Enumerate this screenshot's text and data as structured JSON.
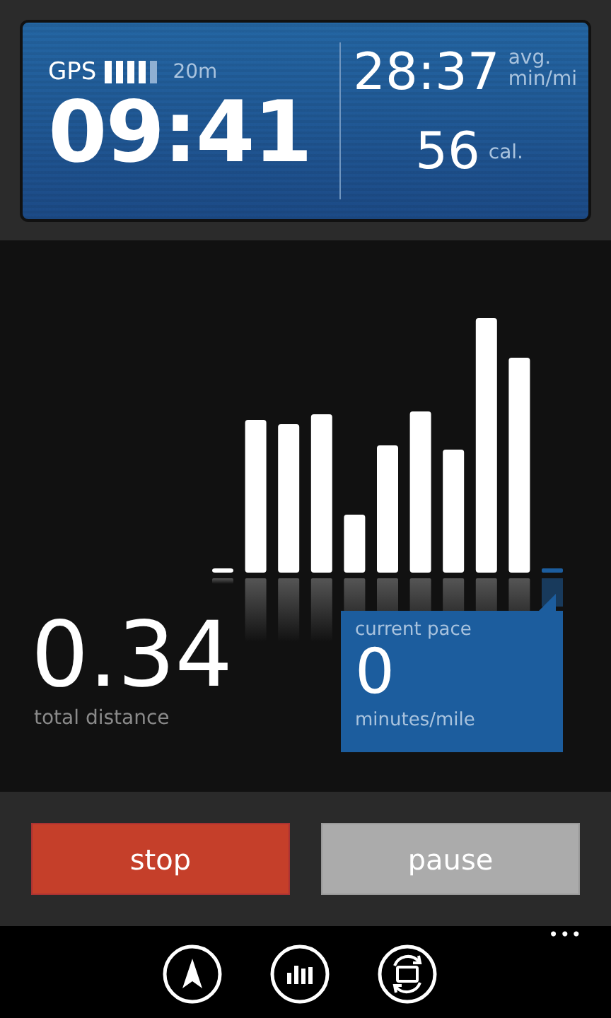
{
  "header": {
    "gps_label": "GPS",
    "gps_accuracy": "20m",
    "elapsed_time": "09:41",
    "avg_pace": "28:37",
    "avg_pace_unit": "avg.\nmin/mi",
    "calories": "56",
    "calories_unit": "cal."
  },
  "distance": {
    "value": "0.34",
    "label": "total distance"
  },
  "current_pace": {
    "label": "current pace",
    "value": "0",
    "unit": "minutes/mile"
  },
  "buttons": [
    {
      "kind": "stop",
      "label": "stop"
    },
    {
      "kind": "pause",
      "label": "pause"
    }
  ],
  "app_bar": {
    "more": "•••"
  }
}
